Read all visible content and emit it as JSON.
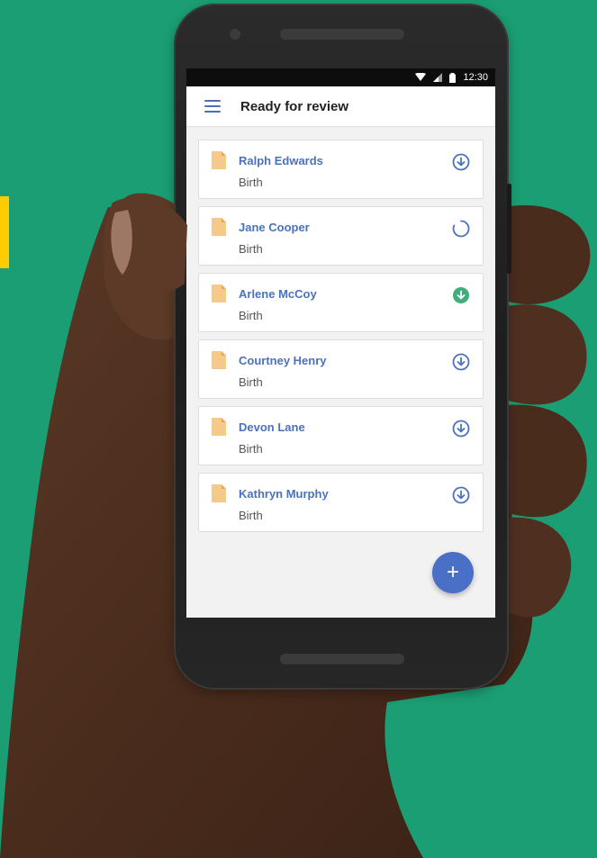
{
  "status_bar": {
    "time": "12:30"
  },
  "app_bar": {
    "title": "Ready for review"
  },
  "records": [
    {
      "name": "Ralph Edwards",
      "type": "Birth",
      "status": "download"
    },
    {
      "name": "Jane Cooper",
      "type": "Birth",
      "status": "loading"
    },
    {
      "name": "Arlene McCoy",
      "type": "Birth",
      "status": "downloaded"
    },
    {
      "name": "Courtney Henry",
      "type": "Birth",
      "status": "download"
    },
    {
      "name": "Devon Lane",
      "type": "Birth",
      "status": "download"
    },
    {
      "name": "Kathryn Murphy",
      "type": "Birth",
      "status": "download"
    }
  ],
  "fab": {
    "icon": "plus-icon",
    "label": "+"
  },
  "colors": {
    "background": "#1b9e74",
    "accent_bar": "#ffcc00",
    "link_blue": "#4a72be",
    "fab_blue": "#4a6fc7",
    "success_green": "#3fae7a",
    "doc_orange": "#f5c98a"
  }
}
